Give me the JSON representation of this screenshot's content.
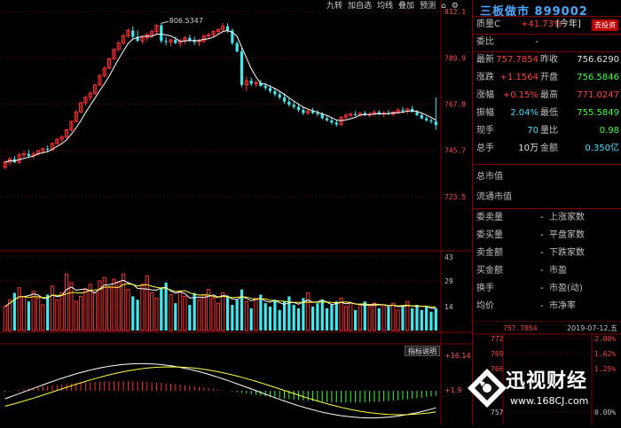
{
  "toolbar": {
    "items": [
      "九转",
      "加自选",
      "均线",
      "叠加",
      "预测"
    ]
  },
  "price_chart": {
    "max_price_label": "806.5347",
    "y_ticks": [
      "812.1",
      "789.9",
      "767.8",
      "745.7",
      "723.5"
    ],
    "candles": [
      [
        737.5,
        741.0,
        736.5,
        740.0
      ],
      [
        740.0,
        742.5,
        738.5,
        741.5
      ],
      [
        741.5,
        743.0,
        739.5,
        740.0
      ],
      [
        740.0,
        744.5,
        739.0,
        743.5
      ],
      [
        743.5,
        745.5,
        742.0,
        744.0
      ],
      [
        744.0,
        746.0,
        742.5,
        743.0
      ],
      [
        743.0,
        745.0,
        741.5,
        744.0
      ],
      [
        744.0,
        746.0,
        743.0,
        745.5
      ],
      [
        745.5,
        747.0,
        744.0,
        746.5
      ],
      [
        746.5,
        748.0,
        745.0,
        746.0
      ],
      [
        746.0,
        749.5,
        745.5,
        749.0
      ],
      [
        749.0,
        751.5,
        748.5,
        751.0
      ],
      [
        751.0,
        753.0,
        749.5,
        752.0
      ],
      [
        752.0,
        756.0,
        751.5,
        755.5
      ],
      [
        755.5,
        760.0,
        754.5,
        759.5
      ],
      [
        759.5,
        765.0,
        759.0,
        764.0
      ],
      [
        764.0,
        769.0,
        763.5,
        768.5
      ],
      [
        768.5,
        772.0,
        767.0,
        771.0
      ],
      [
        771.0,
        774.0,
        769.5,
        773.0
      ],
      [
        773.0,
        777.5,
        772.0,
        777.0
      ],
      [
        777.0,
        782.0,
        776.5,
        781.5
      ],
      [
        781.5,
        786.0,
        780.5,
        785.0
      ],
      [
        785.0,
        790.0,
        784.5,
        789.5
      ],
      [
        789.5,
        794.5,
        789.0,
        794.0
      ],
      [
        794.0,
        798.0,
        793.0,
        797.0
      ],
      [
        797.0,
        801.5,
        796.0,
        800.5
      ],
      [
        800.5,
        804.0,
        799.5,
        803.0
      ],
      [
        803.0,
        805.0,
        799.0,
        800.0
      ],
      [
        800.0,
        803.0,
        797.5,
        798.0
      ],
      [
        798.0,
        800.5,
        796.5,
        799.5
      ],
      [
        799.5,
        802.0,
        798.0,
        801.0
      ],
      [
        801.0,
        803.5,
        799.5,
        802.5
      ],
      [
        802.5,
        806.0,
        801.5,
        805.5
      ],
      [
        805.5,
        806.5,
        797.0,
        798.0
      ],
      [
        798.0,
        800.0,
        796.0,
        797.5
      ],
      [
        797.5,
        799.0,
        795.5,
        798.5
      ],
      [
        798.5,
        800.0,
        796.5,
        797.0
      ],
      [
        797.0,
        799.0,
        795.0,
        798.0
      ],
      [
        798.0,
        800.5,
        796.5,
        799.5
      ],
      [
        799.5,
        801.0,
        797.5,
        798.5
      ],
      [
        798.5,
        800.0,
        796.0,
        797.5
      ],
      [
        797.5,
        799.0,
        795.5,
        798.0
      ],
      [
        798.0,
        801.0,
        797.0,
        800.5
      ],
      [
        800.5,
        802.0,
        799.0,
        801.0
      ],
      [
        801.0,
        803.0,
        799.5,
        802.5
      ],
      [
        802.5,
        804.0,
        801.0,
        803.5
      ],
      [
        803.5,
        806.5,
        802.0,
        805.0
      ],
      [
        805.0,
        806.5,
        802.0,
        803.0
      ],
      [
        803.0,
        804.0,
        796.0,
        797.0
      ],
      [
        797.0,
        798.0,
        792.5,
        793.0
      ],
      [
        793.0,
        794.5,
        776.0,
        777.0
      ],
      [
        777.0,
        781.0,
        774.0,
        779.0
      ],
      [
        779.0,
        780.5,
        776.5,
        777.5
      ],
      [
        777.5,
        779.0,
        776.0,
        778.0
      ],
      [
        778.0,
        779.5,
        776.0,
        776.5
      ],
      [
        776.5,
        778.0,
        774.5,
        775.5
      ],
      [
        775.5,
        777.0,
        773.0,
        774.0
      ],
      [
        774.0,
        775.5,
        771.5,
        772.5
      ],
      [
        772.5,
        774.0,
        770.0,
        771.0
      ],
      [
        771.0,
        773.0,
        768.0,
        769.0
      ],
      [
        769.0,
        771.0,
        766.5,
        767.5
      ],
      [
        767.5,
        769.0,
        765.5,
        766.5
      ],
      [
        766.5,
        768.0,
        764.0,
        765.0
      ],
      [
        765.0,
        766.5,
        762.5,
        763.5
      ],
      [
        763.5,
        765.5,
        762.5,
        764.5
      ],
      [
        764.5,
        766.0,
        763.0,
        763.5
      ],
      [
        763.5,
        765.0,
        762.0,
        763.0
      ],
      [
        763.0,
        764.0,
        760.5,
        761.0
      ],
      [
        761.0,
        762.5,
        759.5,
        760.0
      ],
      [
        760.0,
        761.5,
        758.0,
        759.0
      ],
      [
        759.0,
        760.0,
        757.0,
        758.0
      ],
      [
        758.0,
        762.0,
        757.5,
        761.5
      ],
      [
        761.5,
        763.5,
        760.5,
        762.5
      ],
      [
        762.5,
        764.0,
        761.5,
        763.0
      ],
      [
        763.0,
        764.5,
        762.0,
        762.5
      ],
      [
        762.5,
        764.0,
        761.5,
        763.5
      ],
      [
        763.5,
        764.5,
        762.0,
        762.5
      ],
      [
        762.5,
        764.0,
        761.5,
        763.0
      ],
      [
        763.0,
        765.0,
        762.0,
        764.0
      ],
      [
        764.0,
        765.0,
        762.5,
        763.0
      ],
      [
        763.0,
        764.5,
        761.5,
        763.5
      ],
      [
        763.5,
        765.0,
        762.5,
        763.0
      ],
      [
        763.0,
        764.5,
        762.0,
        764.0
      ],
      [
        764.0,
        766.0,
        763.0,
        765.0
      ],
      [
        765.0,
        766.5,
        763.5,
        764.5
      ],
      [
        764.5,
        766.0,
        763.0,
        765.5
      ],
      [
        765.5,
        767.0,
        764.0,
        764.0
      ],
      [
        764.0,
        765.0,
        762.0,
        762.5
      ],
      [
        762.5,
        763.5,
        760.5,
        761.0
      ],
      [
        761.0,
        762.0,
        759.5,
        760.0
      ],
      [
        760.0,
        761.0,
        758.5,
        759.5
      ],
      [
        759.5,
        771.0,
        755.5,
        757.8
      ]
    ]
  },
  "volume_chart": {
    "y_ticks": [
      "43",
      "29",
      "14"
    ],
    "volumes": [
      14,
      18,
      22,
      25,
      20,
      17,
      23,
      19,
      15,
      21,
      26,
      18,
      22,
      33,
      28,
      17,
      20,
      24,
      27,
      22,
      29,
      31,
      25,
      30,
      28,
      33,
      24,
      20,
      18,
      27,
      32,
      22,
      19,
      25,
      28,
      21,
      16,
      23,
      20,
      15,
      22,
      18,
      21,
      24,
      19,
      16,
      22,
      20,
      15,
      18,
      24,
      17,
      13,
      19,
      21,
      16,
      14,
      18,
      12,
      17,
      20,
      15,
      13,
      19,
      22,
      14,
      16,
      18,
      13,
      15,
      17,
      19,
      14,
      16,
      12,
      15,
      17,
      14,
      16,
      13,
      15,
      14,
      16,
      12,
      14,
      17,
      13,
      15,
      12,
      14,
      11,
      13
    ],
    "ma_fast": 16,
    "ma_slow": 15
  },
  "indicator": {
    "button_label": "指标说明",
    "top_label": "16.14",
    "mid_label": "1.9"
  },
  "panel": {
    "stock_title": "三板做市 899002",
    "quality_label": "质量C",
    "quality_value": "+41.73%",
    "quality_period": "[今年]",
    "goto_label": "去投资",
    "rows": [
      {
        "l1": "委比",
        "v1": "-",
        "c1": "white",
        "l2": "",
        "v2": "",
        "c2": "white"
      },
      {
        "l1": "最新",
        "v1": "757.7854",
        "c1": "red",
        "l2": "昨收",
        "v2": "756.6290",
        "c2": "white"
      },
      {
        "l1": "涨跌",
        "v1": "+1.1564",
        "c1": "red",
        "l2": "开盘",
        "v2": "756.5846",
        "c2": "green"
      },
      {
        "l1": "涨幅",
        "v1": "+0.15%",
        "c1": "red",
        "l2": "最高",
        "v2": "771.0247",
        "c2": "red"
      },
      {
        "l1": "振幅",
        "v1": "2.04%",
        "c1": "cyan",
        "l2": "最低",
        "v2": "755.5849",
        "c2": "green"
      },
      {
        "l1": "现手",
        "v1": "70",
        "c1": "cyan",
        "l2": "量比",
        "v2": "0.98",
        "c2": "green"
      },
      {
        "l1": "总手",
        "v1": "10万",
        "c1": "white",
        "l2": "金额",
        "v2": "0.350亿",
        "c2": "cyan"
      }
    ],
    "rows2": [
      {
        "l1": "总市值",
        "l2": ""
      },
      {
        "l1": "流通市值",
        "l2": ""
      }
    ],
    "rows3": [
      {
        "l1": "委卖量",
        "v1": "-",
        "l2": "上涨家数",
        "v2": ""
      },
      {
        "l1": "委买量",
        "v1": "-",
        "l2": "平盘家数",
        "v2": ""
      },
      {
        "l1": "卖金额",
        "v1": "-",
        "l2": "下跌家数",
        "v2": ""
      },
      {
        "l1": "买金额",
        "v1": "-",
        "l2": "市盈",
        "v2": ""
      },
      {
        "l1": "换手",
        "v1": "-",
        "l2": "市盈(动)",
        "v2": ""
      },
      {
        "l1": "均价",
        "v1": "-",
        "l2": "市净率",
        "v2": ""
      }
    ]
  },
  "mini_chart": {
    "price": "757.7854",
    "date": "2019-07-12,五",
    "left_ticks": [
      "772",
      "769",
      "766",
      "757"
    ],
    "right_ticks": [
      "2.00%",
      "1.62%",
      "1.25%",
      "0.00%"
    ]
  },
  "watermark": {
    "title": "迅视财经",
    "url": "www.168CJ.com"
  },
  "colors": {
    "up": "#ff3030",
    "down": "#40e8f0",
    "frame": "#800000"
  }
}
